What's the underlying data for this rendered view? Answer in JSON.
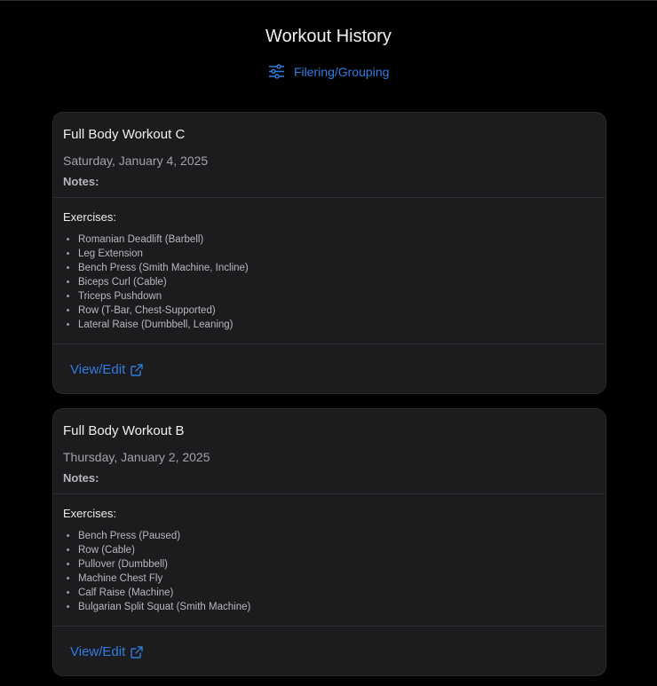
{
  "header": {
    "title": "Workout History",
    "filter_label": "Filering/Grouping"
  },
  "colors": {
    "background": "#000000",
    "card": "#1c1c1f",
    "accent": "#2f7de1"
  },
  "workouts": [
    {
      "title": "Full Body Workout C",
      "date": "Saturday, January 4, 2025",
      "notes_label": "Notes:",
      "exercises_label": "Exercises:",
      "exercises": [
        "Romanian Deadlift (Barbell)",
        "Leg Extension",
        "Bench Press (Smith Machine, Incline)",
        "Biceps Curl (Cable)",
        "Triceps Pushdown",
        "Row (T-Bar, Chest-Supported)",
        "Lateral Raise (Dumbbell, Leaning)"
      ],
      "action_label": "View/Edit",
      "action_icon": "external-link-icon"
    },
    {
      "title": "Full Body Workout B",
      "date": "Thursday, January 2, 2025",
      "notes_label": "Notes:",
      "exercises_label": "Exercises:",
      "exercises": [
        "Bench Press (Paused)",
        "Row (Cable)",
        "Pullover (Dumbbell)",
        "Machine Chest Fly",
        "Calf Raise (Machine)",
        "Bulgarian Split Squat (Smith Machine)"
      ],
      "action_label": "View/Edit",
      "action_icon": "external-link-icon"
    }
  ]
}
